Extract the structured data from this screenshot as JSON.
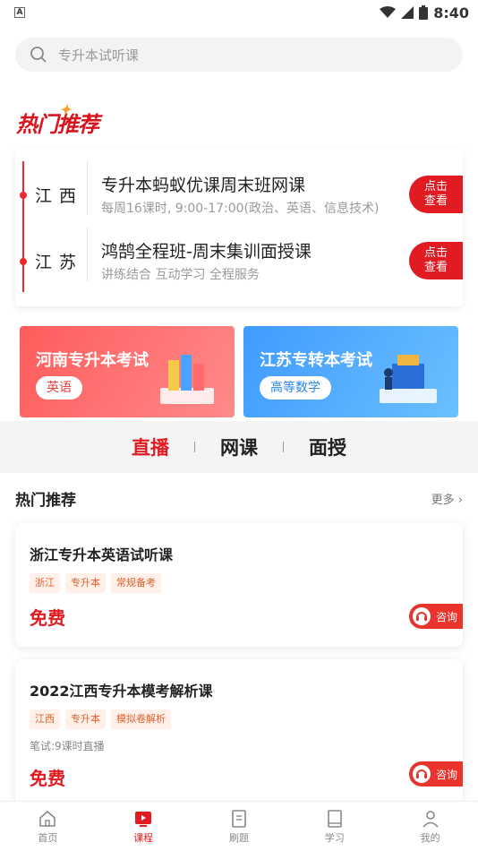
{
  "status_bar": {
    "left_icon": "A",
    "time": "8:40"
  },
  "search": {
    "placeholder": "专升本试听课"
  },
  "hot_title": "热门推荐",
  "recommendations": [
    {
      "province": "江西",
      "title": "专升本蚂蚁优课周末班网课",
      "subtitle": "每周16课时, 9:00-17:00(政治、英语、信息技术)",
      "button_line1": "点击",
      "button_line2": "查看"
    },
    {
      "province": "江苏",
      "title": "鸿鹄全程班-周末集训面授课",
      "subtitle": "讲练结合  互动学习  全程服务",
      "button_line1": "点击",
      "button_line2": "查看"
    }
  ],
  "banners": [
    {
      "title": "河南专升本考试",
      "pill": "英语"
    },
    {
      "title": "江苏专转本考试",
      "pill": "高等数学"
    }
  ],
  "tabs": [
    "直播",
    "网课",
    "面授"
  ],
  "section": {
    "title": "热门推荐",
    "more": "更多"
  },
  "courses": [
    {
      "title": "浙江专升本英语试听课",
      "tags": [
        "浙江",
        "专升本",
        "常规备考"
      ],
      "info": "",
      "price": "免费",
      "consult": "咨询"
    },
    {
      "title": "2022江西专升本模考解析课",
      "tags": [
        "江西",
        "专升本",
        "模拟卷解析"
      ],
      "info": "笔试:9课时直播",
      "price": "免费",
      "consult": "咨询"
    }
  ],
  "nav": [
    {
      "label": "首页"
    },
    {
      "label": "课程"
    },
    {
      "label": "刷题"
    },
    {
      "label": "学习"
    },
    {
      "label": "我的"
    }
  ],
  "colors": {
    "accent": "#e01b22",
    "tag_bg": "#fff1ea",
    "tag_text": "#e5602a"
  }
}
